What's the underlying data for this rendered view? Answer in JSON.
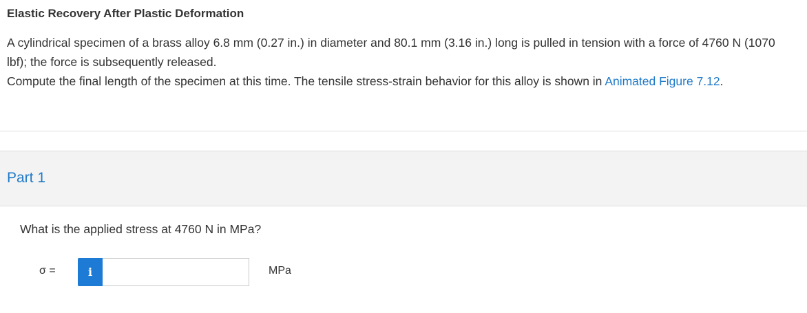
{
  "problem": {
    "title": "Elastic Recovery After Plastic Deformation",
    "paragraph1": "A cylindrical specimen of a brass alloy 6.8 mm (0.27 in.) in diameter and 80.1 mm (3.16 in.) long is pulled in tension with a force of 4760 N (1070 lbf); the force is subsequently released.",
    "paragraph2_prefix": "Compute the final length of the specimen at this time. The tensile stress-strain behavior for this alloy is shown in ",
    "figure_link": "Animated Figure 7.12",
    "paragraph2_suffix": "."
  },
  "part": {
    "title": "Part 1",
    "question": "What is the applied stress at 4760 N in MPa?",
    "answer": {
      "symbol": "σ =",
      "info_icon": "info-icon",
      "info_glyph": "i",
      "value": "",
      "placeholder": "",
      "unit": "MPa"
    }
  },
  "colors": {
    "link": "#1f7ac7",
    "info_button": "#1d7bd6",
    "part_header_bg": "#f3f3f3"
  }
}
